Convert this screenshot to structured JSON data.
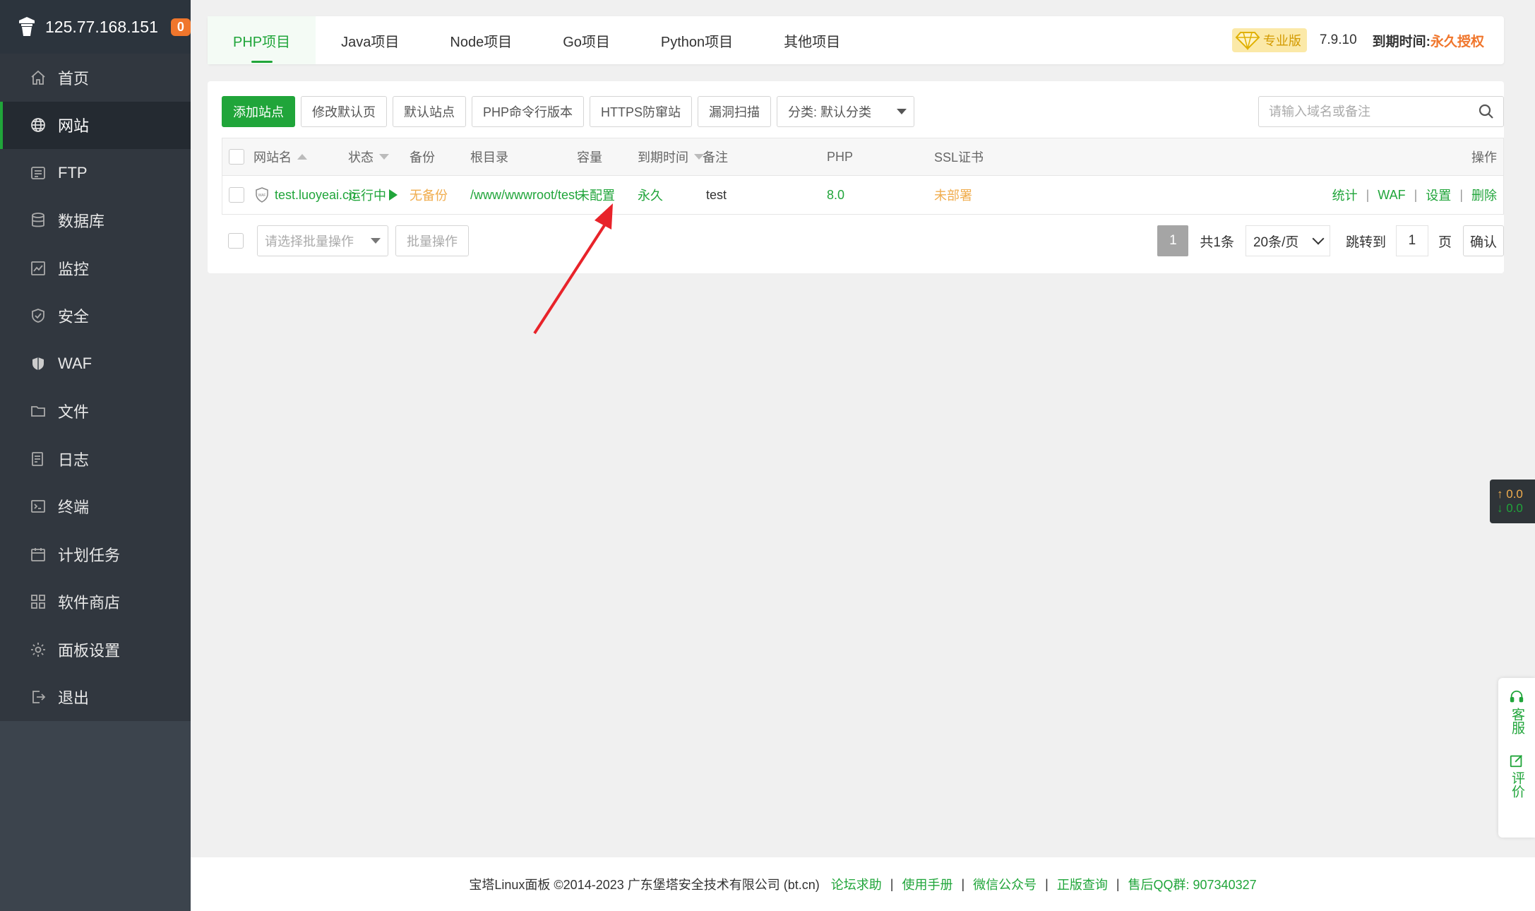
{
  "server": {
    "ip": "125.77.168.151",
    "badge_count": "0"
  },
  "sidebar": {
    "items": [
      {
        "label": "首页",
        "icon": "home-icon"
      },
      {
        "label": "网站",
        "icon": "globe-icon",
        "active": true
      },
      {
        "label": "FTP",
        "icon": "ftp-icon"
      },
      {
        "label": "数据库",
        "icon": "database-icon"
      },
      {
        "label": "监控",
        "icon": "monitor-icon"
      },
      {
        "label": "安全",
        "icon": "shield-icon"
      },
      {
        "label": "WAF",
        "icon": "waf-shield-icon"
      },
      {
        "label": "文件",
        "icon": "folder-icon"
      },
      {
        "label": "日志",
        "icon": "log-icon"
      },
      {
        "label": "终端",
        "icon": "terminal-icon"
      },
      {
        "label": "计划任务",
        "icon": "calendar-icon"
      },
      {
        "label": "软件商店",
        "icon": "apps-icon"
      },
      {
        "label": "面板设置",
        "icon": "gear-icon"
      },
      {
        "label": "退出",
        "icon": "logout-icon"
      }
    ]
  },
  "tabs": [
    "PHP项目",
    "Java项目",
    "Node项目",
    "Go项目",
    "Python项目",
    "其他项目"
  ],
  "header": {
    "edition": "专业版",
    "version": "7.9.10",
    "expire_label": "到期时间:",
    "expire_value": "永久授权"
  },
  "toolbar": {
    "add_site": "添加站点",
    "edit_default_page": "修改默认页",
    "default_site": "默认站点",
    "php_cli_version": "PHP命令行版本",
    "https_anti_crawl": "HTTPS防窜站",
    "vuln_scan": "漏洞扫描",
    "category": "分类: 默认分类"
  },
  "search": {
    "placeholder": "请输入域名或备注"
  },
  "table": {
    "headers": {
      "site_name": "网站名",
      "status": "状态",
      "backup": "备份",
      "root_dir": "根目录",
      "capacity": "容量",
      "expire": "到期时间",
      "note": "备注",
      "php": "PHP",
      "ssl": "SSL证书",
      "ops": "操作"
    },
    "rows": [
      {
        "site_name": "test.luoyeai.cn",
        "status": "运行中",
        "backup": "无备份",
        "root_dir": "/www/wwwroot/test",
        "capacity": "未配置",
        "expire": "永久",
        "note": "test",
        "php": "8.0",
        "ssl": "未部署",
        "ops": [
          "统计",
          "WAF",
          "设置",
          "删除"
        ]
      }
    ]
  },
  "batch": {
    "placeholder": "请选择批量操作",
    "button": "批量操作"
  },
  "pager": {
    "current": "1",
    "total": "共1条",
    "page_size": "20条/页",
    "jump_label": "跳转到",
    "jump_value": "1",
    "page_unit": "页",
    "confirm": "确认"
  },
  "netspeed": {
    "up": "0.0",
    "down": "0.0"
  },
  "float": {
    "service": "客服",
    "review": "评价"
  },
  "footer": {
    "copyright": "宝塔Linux面板 ©2014-2023 广东堡塔安全技术有限公司 (bt.cn)",
    "links": [
      "论坛求助",
      "使用手册",
      "微信公众号",
      "正版查询",
      "售后QQ群: 907340327"
    ]
  },
  "colors": {
    "accent": "#20a53a",
    "sidebar_bg": "#3c444d",
    "warning": "#f0ad4e",
    "brand_orange": "#f0762c"
  }
}
